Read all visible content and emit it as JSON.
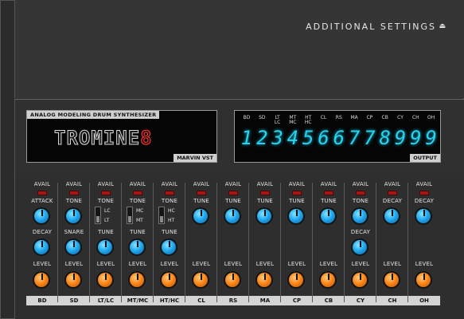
{
  "top": {
    "settings_label": "ADDITIONAL SETTINGS",
    "settings_icon": "eject-triangle-icon"
  },
  "logo": {
    "subtitle": "ANALOG MODELING DRUM SYNTHESIZER",
    "name_main": "TROMINE",
    "name_num": "8",
    "brand": "MARVIN VST"
  },
  "output": {
    "tag": "OUTPUT",
    "labels": [
      "BD",
      "SD",
      "LT\nLC",
      "MT\nMC",
      "HT\nHC",
      "CL",
      "RS",
      "MA",
      "CP",
      "CB",
      "CY",
      "CH",
      "OH"
    ],
    "digits": [
      "1",
      "2",
      "3",
      "4",
      "5",
      "6",
      "6",
      "7",
      "7",
      "8",
      "9",
      "9",
      "9"
    ],
    "digit_color": "#28d3ee"
  },
  "channels": [
    {
      "name": "BD",
      "avail": "AVAIL",
      "top": "ATTACK",
      "mid": "DECAY",
      "level": "LEVEL"
    },
    {
      "name": "SD",
      "avail": "AVAIL",
      "top": "TONE",
      "mid": "SNARE",
      "level": "LEVEL"
    },
    {
      "name": "LT/LC",
      "avail": "AVAIL",
      "top": "TONE",
      "sw_hi": "LC",
      "sw_lo": "LT",
      "mid": "TUNE",
      "level": "LEVEL"
    },
    {
      "name": "MT/MC",
      "avail": "AVAIL",
      "top": "TONE",
      "sw_hi": "MC",
      "sw_lo": "MT",
      "mid": "TUNE",
      "level": "LEVEL"
    },
    {
      "name": "HT/HC",
      "avail": "AVAIL",
      "top": "TONE",
      "sw_hi": "HC",
      "sw_lo": "HT",
      "mid": "TUNE",
      "level": "LEVEL"
    },
    {
      "name": "CL",
      "avail": "AVAIL",
      "top": "TUNE",
      "level": "LEVEL"
    },
    {
      "name": "RS",
      "avail": "AVAIL",
      "top": "TUNE",
      "level": "LEVEL"
    },
    {
      "name": "MA",
      "avail": "AVAIL",
      "top": "TUNE",
      "level": "LEVEL"
    },
    {
      "name": "CP",
      "avail": "AVAIL",
      "top": "TUNE",
      "level": "LEVEL"
    },
    {
      "name": "CB",
      "avail": "AVAIL",
      "top": "TUNE",
      "level": "LEVEL"
    },
    {
      "name": "CY",
      "avail": "AVAIL",
      "top": "TONE",
      "mid": "DECAY",
      "level": "LEVEL"
    },
    {
      "name": "CH",
      "avail": "AVAIL",
      "top": "DECAY",
      "level": "LEVEL"
    },
    {
      "name": "OH",
      "avail": "AVAIL",
      "top": "DECAY",
      "level": "LEVEL"
    }
  ],
  "colors": {
    "led": "#a51515",
    "knob_blue": "#23aaf0",
    "knob_orange": "#ff8a1c"
  }
}
